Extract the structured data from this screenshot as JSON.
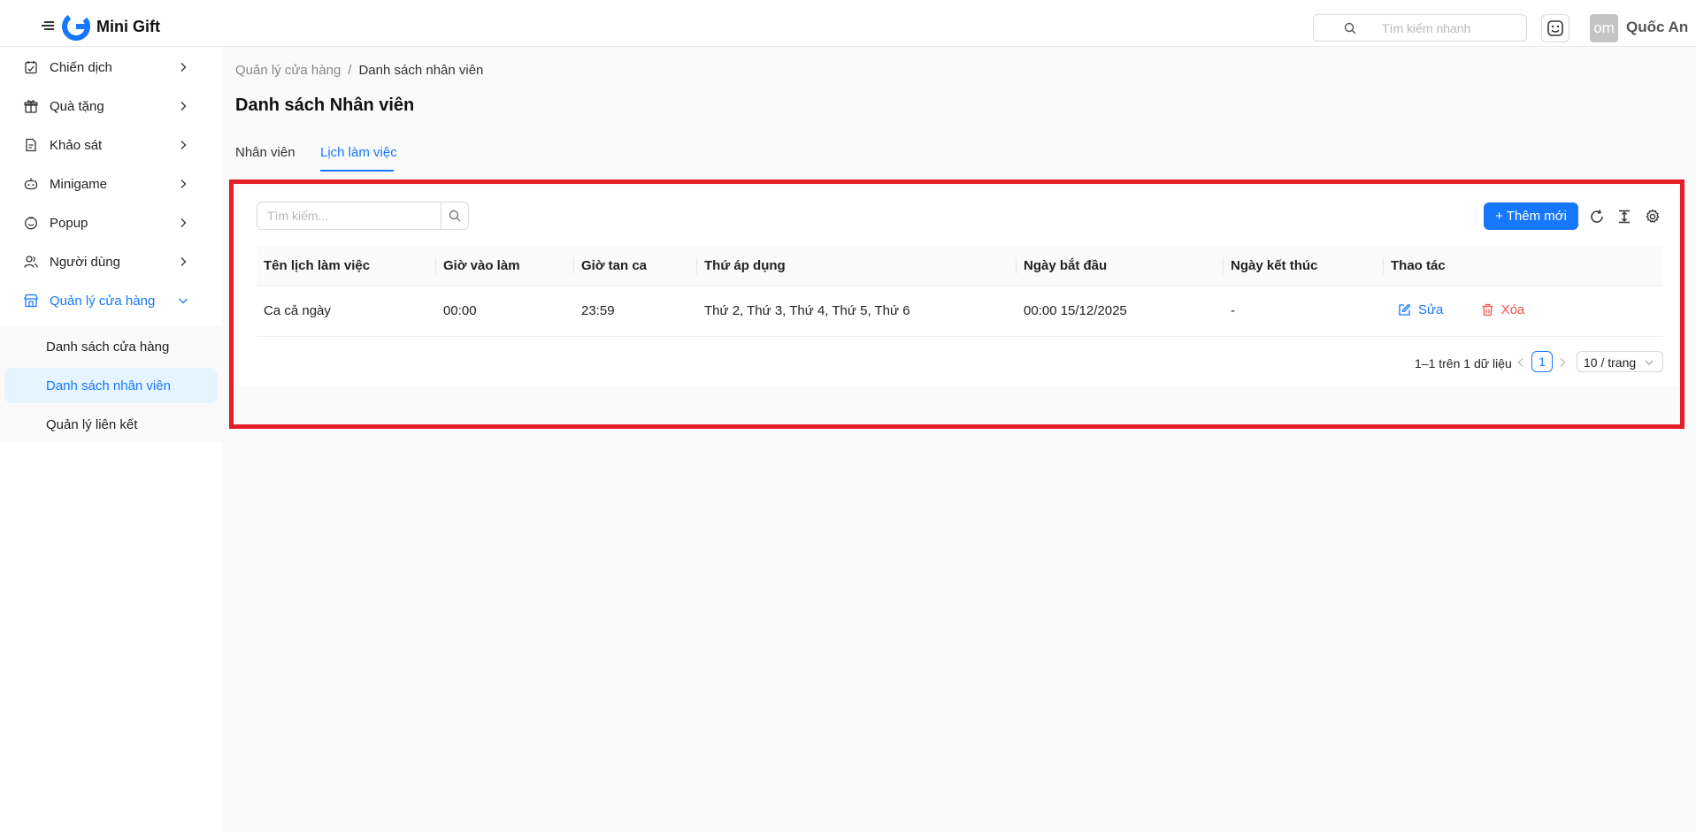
{
  "header": {
    "app_name": "Mini Gift",
    "search_placeholder": "Tìm kiếm nhanh",
    "avatar_initials": "om",
    "user_name": "Quốc An"
  },
  "sidebar": {
    "items": [
      {
        "label": "Chiến dịch",
        "icon": "campaign-icon"
      },
      {
        "label": "Quà tặng",
        "icon": "gift-icon"
      },
      {
        "label": "Khảo sát",
        "icon": "survey-icon"
      },
      {
        "label": "Minigame",
        "icon": "game-icon"
      },
      {
        "label": "Popup",
        "icon": "popup-icon"
      },
      {
        "label": "Người dùng",
        "icon": "users-icon"
      },
      {
        "label": "Quản lý cửa hàng",
        "icon": "store-icon",
        "expanded": true
      }
    ],
    "subitems": [
      {
        "label": "Danh sách cửa hàng"
      },
      {
        "label": "Danh sách nhân viên",
        "selected": true
      },
      {
        "label": "Quản lý liên kết"
      }
    ]
  },
  "breadcrumb": {
    "parent": "Quản lý cửa hàng",
    "separator": "/",
    "current": "Danh sách nhân viên"
  },
  "page_title": "Danh sách Nhân viên",
  "tabs": [
    {
      "label": "Nhân viên"
    },
    {
      "label": "Lịch làm việc",
      "active": true
    }
  ],
  "toolbar": {
    "search_placeholder": "Tìm kiếm...",
    "add_label": "+ Thêm mới"
  },
  "table": {
    "columns": [
      "Tên lịch làm việc",
      "Giờ vào làm",
      "Giờ tan ca",
      "Thứ áp dụng",
      "Ngày bắt đầu",
      "Ngày kết thúc",
      "Thao tác"
    ],
    "rows": [
      {
        "name": "Ca cả ngày",
        "start_time": "00:00",
        "end_time": "23:59",
        "weekdays": "Thứ 2, Thứ 3, Thứ 4, Thứ 5, Thứ 6",
        "start_date": "00:00 15/12/2025",
        "end_date": "-",
        "edit_label": "Sửa",
        "delete_label": "Xóa"
      }
    ]
  },
  "pagination": {
    "total_text": "1–1 trên 1 dữ liệu",
    "current_page": "1",
    "page_size": "10 / trang"
  },
  "colors": {
    "primary": "#1677ff",
    "danger": "#ff4d4f",
    "highlight": "#e41e26"
  }
}
